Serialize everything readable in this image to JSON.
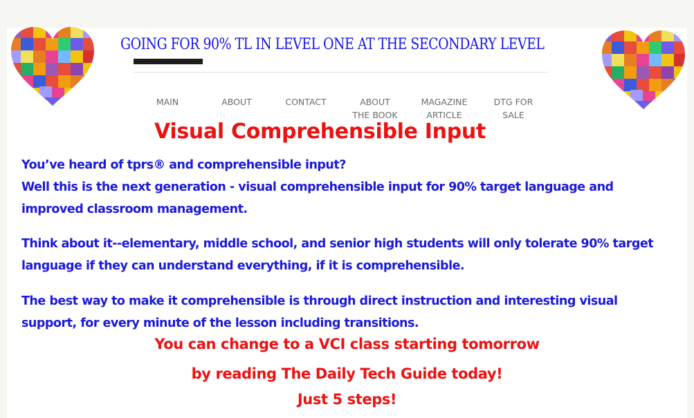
{
  "header": {
    "site_title": "GOING FOR 90% TL  IN LEVEL ONE AT THE SECONDARY  LEVEL",
    "logo_left": "puzzle-heart-logo",
    "logo_right": "puzzle-heart-logo"
  },
  "nav": {
    "items": [
      {
        "line1": "MAIN",
        "line2": ""
      },
      {
        "line1": "ABOUT",
        "line2": ""
      },
      {
        "line1": "CONTACT",
        "line2": ""
      },
      {
        "line1": "ABOUT",
        "line2": "THE BOOK"
      },
      {
        "line1": "MAGAZINE",
        "line2": "ARTICLE"
      },
      {
        "line1": "DTG FOR",
        "line2": "SALE"
      }
    ]
  },
  "main": {
    "heading": "Visual Comprehensible Input",
    "paragraphs": [
      {
        "lines": [
          "You’ve heard of tprs® and comprehensible input?",
          "Well this is the next generation - visual comprehensible input for 90% target language and",
          "improved classroom management."
        ]
      },
      {
        "lines": [
          "Think about it--elementary, middle school, and senior high students will only tolerate 90% target",
          "language if they can understand everything, if it is comprehensible."
        ]
      },
      {
        "lines": [
          "The best way to make it comprehensible is through direct instruction and interesting visual",
          "support, for every minute of the lesson including transitions."
        ]
      }
    ],
    "cta": [
      "You can change to a VCI class starting tomorrow",
      "by reading The Daily Tech Guide today!",
      "Just 5 steps!"
    ]
  },
  "colors": {
    "title_blue": "#1515e8",
    "body_blue": "#1a1ad8",
    "accent_red": "#ee1111",
    "nav_gray": "#6a6a6a",
    "page_bg": "#f6f6f2"
  }
}
